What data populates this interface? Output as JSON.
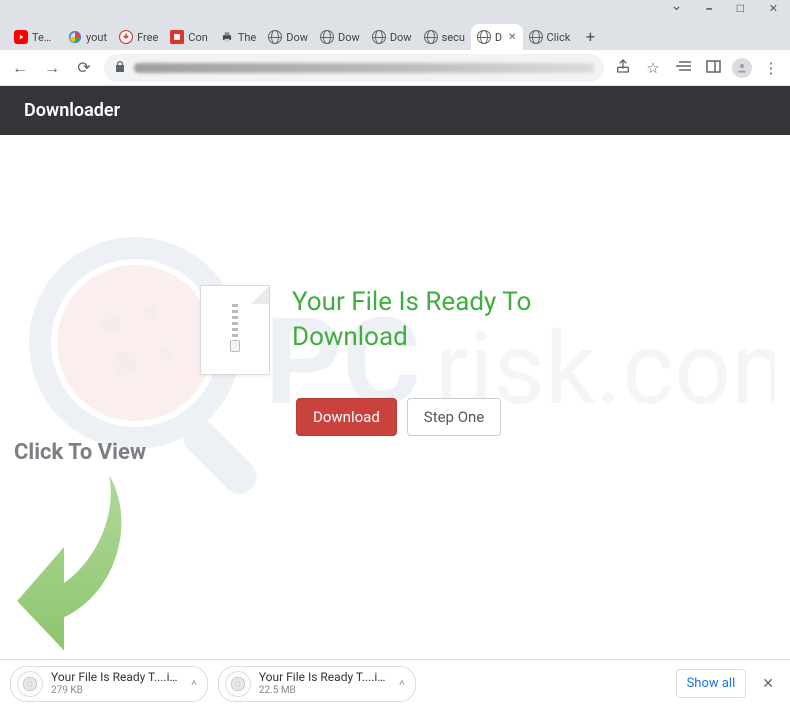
{
  "window": {
    "controls": [
      "chev",
      "min",
      "max",
      "close"
    ]
  },
  "tabs": [
    {
      "title": "Tesla",
      "favicon": "youtube"
    },
    {
      "title": "yout",
      "favicon": "google"
    },
    {
      "title": "Free",
      "favicon": "red-down"
    },
    {
      "title": "Con",
      "favicon": "red-square"
    },
    {
      "title": "The",
      "favicon": "printer"
    },
    {
      "title": "Dow",
      "favicon": "globe"
    },
    {
      "title": "Dow",
      "favicon": "globe"
    },
    {
      "title": "Dow",
      "favicon": "globe"
    },
    {
      "title": "secu",
      "favicon": "globe"
    },
    {
      "title": "D",
      "favicon": "globe",
      "active": true,
      "closeable": true
    },
    {
      "title": "Click",
      "favicon": "globe"
    }
  ],
  "toolbar": {
    "secure": true,
    "icons": [
      "share",
      "star",
      "reader",
      "panel",
      "avatar",
      "menu"
    ]
  },
  "page": {
    "site_title": "Downloader",
    "heading": "Your File Is Ready To Download",
    "download_label": "Download",
    "step_label": "Step One",
    "click_to_view": "Click To View",
    "watermark_text": "PCrisk.com"
  },
  "downloads": {
    "items": [
      {
        "name": "Your File Is Ready T....iso",
        "size": "279 KB"
      },
      {
        "name": "Your File Is Ready T....iso",
        "size": "22.5 MB"
      }
    ],
    "show_all": "Show all"
  }
}
